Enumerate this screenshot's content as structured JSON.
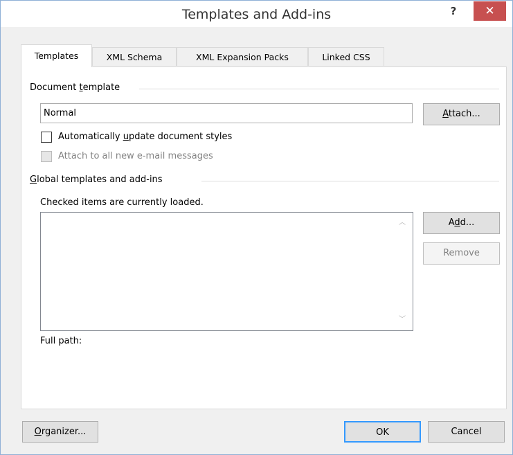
{
  "window": {
    "title": "Templates and Add-ins",
    "help_label": "?",
    "close_label": "✕"
  },
  "tabs": [
    {
      "label": "Templates",
      "active": true
    },
    {
      "label": "XML Schema",
      "active": false
    },
    {
      "label": "XML Expansion Packs",
      "active": false
    },
    {
      "label": "Linked CSS",
      "active": false
    }
  ],
  "document_template": {
    "section_pre": "Document ",
    "section_accel": "t",
    "section_post": "emplate",
    "value": "Normal",
    "attach_button": {
      "accel": "A",
      "rest": "ttach..."
    },
    "auto_update": {
      "pre": "Automatically ",
      "accel": "u",
      "post": "pdate document styles",
      "checked": false
    },
    "attach_email": {
      "label": "Attach to all new e-mail messages",
      "checked": false,
      "disabled": true
    }
  },
  "global_templates": {
    "section_accel": "G",
    "section_rest": "lobal templates and add-ins",
    "hint": "Checked items are currently loaded.",
    "items": [],
    "add_button": {
      "pre": "A",
      "accel": "d",
      "post": "d..."
    },
    "remove_button": "Remove",
    "full_path_label": "Full path:"
  },
  "footer": {
    "organizer_button": {
      "accel": "O",
      "rest": "rganizer..."
    },
    "ok_button": "OK",
    "cancel_button": "Cancel"
  },
  "colors": {
    "close_button_bg": "#c75050",
    "dialog_bg": "#f0f0f0",
    "panel_bg": "#ffffff"
  }
}
